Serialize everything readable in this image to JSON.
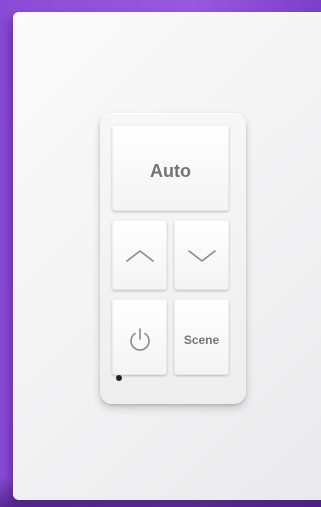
{
  "keypad": {
    "auto_label": "Auto",
    "scene_label": "Scene",
    "icons": {
      "up": "chevron-up-icon",
      "down": "chevron-down-icon",
      "power": "power-icon"
    },
    "led_color": "#222222"
  },
  "colors": {
    "background": "#9a58e0",
    "plate": "#f4f4f5",
    "key_label": "#747474"
  }
}
